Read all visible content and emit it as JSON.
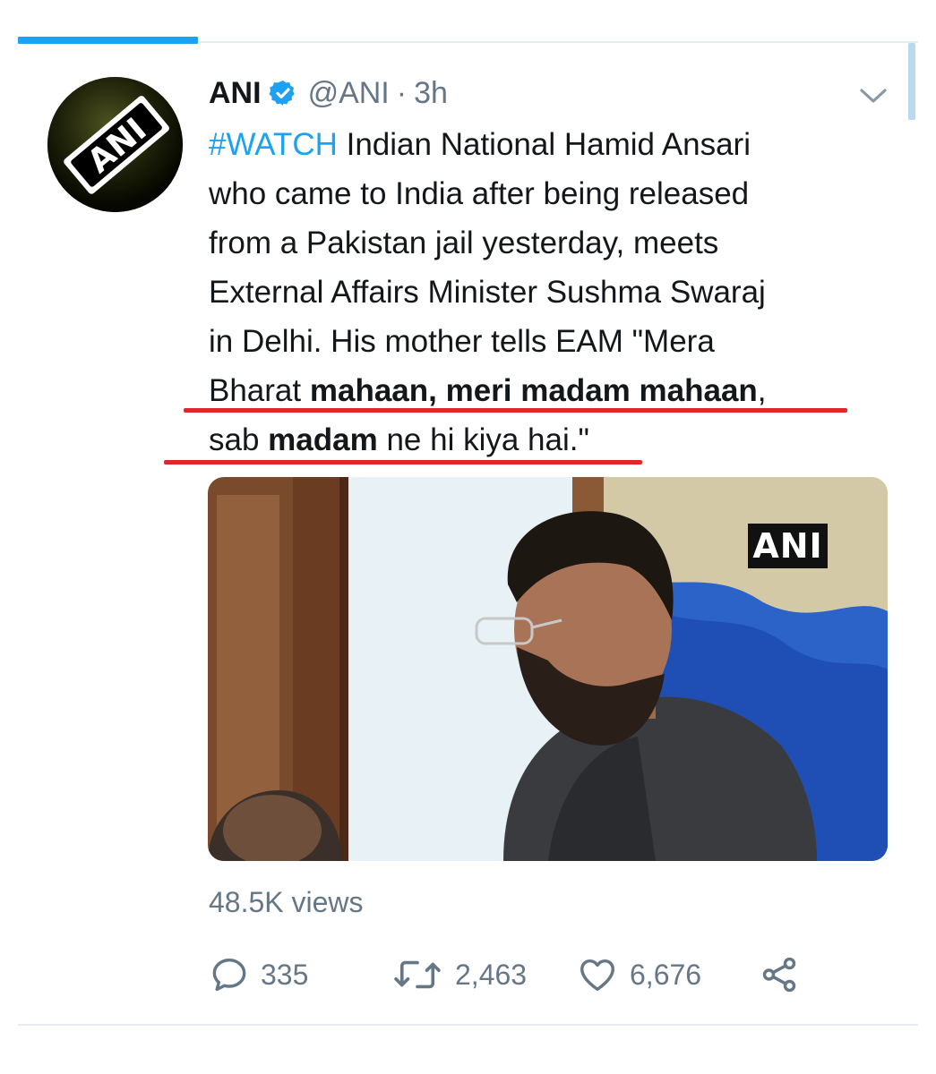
{
  "colors": {
    "accent": "#1da1f2",
    "text": "#14171a",
    "secondary": "#657786",
    "underline": "#e02828"
  },
  "tweet": {
    "display_name": "ANI",
    "handle": "@ANI",
    "separator": "·",
    "time": "3h",
    "avatar_text": "ANI",
    "text_lines": {
      "l1_hashtag": "#WATCH",
      "l1_rest": " Indian National Hamid Ansari",
      "l2": "who came to India after being released",
      "l3": "from a Pakistan jail yesterday, meets",
      "l4": "External Affairs Minister Sushma Swaraj",
      "l5": "in Delhi. His mother tells EAM \"Mera",
      "l6_a": "Bharat ",
      "l6_b": "mahaan, meri madam mahaan",
      "l6_c": ",",
      "l7_a": "sab ",
      "l7_b": "madam",
      "l7_c": " ne hi kiya hai.\""
    },
    "media": {
      "watermark": "ANI"
    },
    "views": "48.5K views",
    "actions": {
      "reply_count": "335",
      "retweet_count": "2,463",
      "like_count": "6,676"
    },
    "icons": [
      "verified-icon",
      "chevron-down-icon",
      "reply-icon",
      "retweet-icon",
      "like-icon",
      "share-icon"
    ]
  }
}
